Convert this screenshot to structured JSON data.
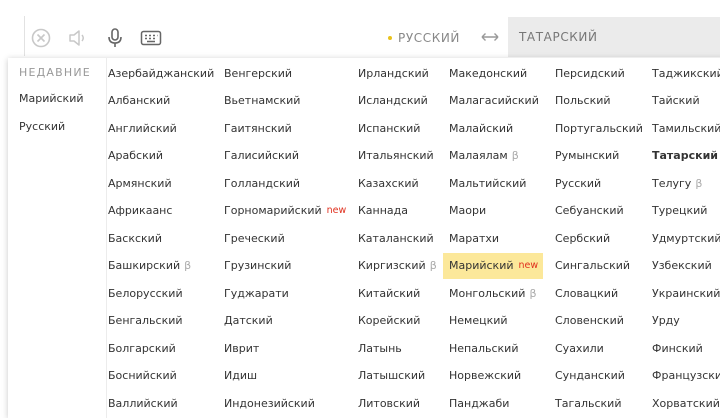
{
  "toolbar": {
    "icons": [
      "clear-icon",
      "speaker-icon",
      "microphone-icon",
      "keyboard-icon"
    ],
    "source_language": "РУССКИЙ",
    "swap_icon": "swap-arrows-icon",
    "target_language": "ТАТАРСКИЙ"
  },
  "recent": {
    "header": "НЕДАВНИЕ",
    "items": [
      "Марийский",
      "Русский"
    ]
  },
  "tags": {
    "beta": "β",
    "new": "new"
  },
  "colors": {
    "highlight": "#fce89a",
    "new_tag": "#e0301e",
    "accent_dot": "#e8c21c"
  },
  "columns": [
    [
      {
        "name": "Азербайджанский"
      },
      {
        "name": "Албанский"
      },
      {
        "name": "Английский"
      },
      {
        "name": "Арабский"
      },
      {
        "name": "Армянский"
      },
      {
        "name": "Африкаанс"
      },
      {
        "name": "Баскский"
      },
      {
        "name": "Башкирский",
        "beta": true
      },
      {
        "name": "Белорусский"
      },
      {
        "name": "Бенгальский"
      },
      {
        "name": "Болгарский"
      },
      {
        "name": "Боснийский"
      },
      {
        "name": "Валлийский"
      }
    ],
    [
      {
        "name": "Венгерский"
      },
      {
        "name": "Вьетнамский"
      },
      {
        "name": "Гаитянский"
      },
      {
        "name": "Галисийский"
      },
      {
        "name": "Голландский"
      },
      {
        "name": "Горномарийский",
        "new": true
      },
      {
        "name": "Греческий"
      },
      {
        "name": "Грузинский"
      },
      {
        "name": "Гуджарати"
      },
      {
        "name": "Датский"
      },
      {
        "name": "Иврит"
      },
      {
        "name": "Идиш"
      },
      {
        "name": "Индонезийский"
      }
    ],
    [
      {
        "name": "Ирландский"
      },
      {
        "name": "Исландский"
      },
      {
        "name": "Испанский"
      },
      {
        "name": "Итальянский"
      },
      {
        "name": "Казахский"
      },
      {
        "name": "Каннада"
      },
      {
        "name": "Каталанский"
      },
      {
        "name": "Киргизский",
        "beta": true
      },
      {
        "name": "Китайский"
      },
      {
        "name": "Корейский"
      },
      {
        "name": "Латынь"
      },
      {
        "name": "Латышский"
      },
      {
        "name": "Литовский"
      }
    ],
    [
      {
        "name": "Македонский"
      },
      {
        "name": "Малагасийский"
      },
      {
        "name": "Малайский"
      },
      {
        "name": "Малаялам",
        "beta": true
      },
      {
        "name": "Мальтийский"
      },
      {
        "name": "Маори"
      },
      {
        "name": "Маратхи"
      },
      {
        "name": "Марийский",
        "new": true,
        "highlight": true
      },
      {
        "name": "Монгольский",
        "beta": true
      },
      {
        "name": "Немецкий"
      },
      {
        "name": "Непальский"
      },
      {
        "name": "Норвежский"
      },
      {
        "name": "Панджаби"
      }
    ],
    [
      {
        "name": "Персидский"
      },
      {
        "name": "Польский"
      },
      {
        "name": "Португальский"
      },
      {
        "name": "Румынский"
      },
      {
        "name": "Русский"
      },
      {
        "name": "Себуанский"
      },
      {
        "name": "Сербский"
      },
      {
        "name": "Сингальский"
      },
      {
        "name": "Словацкий"
      },
      {
        "name": "Словенский"
      },
      {
        "name": "Суахили"
      },
      {
        "name": "Сунданский"
      },
      {
        "name": "Тагальский"
      }
    ],
    [
      {
        "name": "Таджикский"
      },
      {
        "name": "Тайский"
      },
      {
        "name": "Тамильский"
      },
      {
        "name": "Татарский",
        "selected": true
      },
      {
        "name": "Телугу",
        "beta": true
      },
      {
        "name": "Турецкий"
      },
      {
        "name": "Удмуртский"
      },
      {
        "name": "Узбекский"
      },
      {
        "name": "Украинский"
      },
      {
        "name": "Урду"
      },
      {
        "name": "Финский"
      },
      {
        "name": "Французский"
      },
      {
        "name": "Хорватский"
      }
    ]
  ]
}
